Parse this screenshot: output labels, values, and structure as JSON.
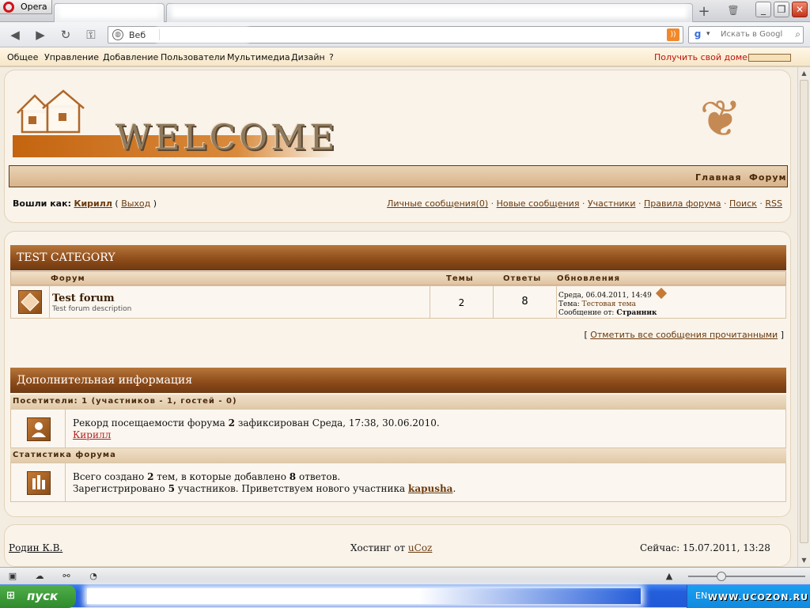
{
  "browser": {
    "opera_label": "Opera",
    "url_label": "Веб",
    "search_placeholder": "Искать в Googl"
  },
  "ucoz_menu": {
    "items": [
      "Общее",
      "Управление",
      "Добавление",
      "Пользователи",
      "Мультимедиа",
      "Дизайн",
      "?"
    ],
    "domain_link": "Получить свой домен"
  },
  "header": {
    "logo_text": "WELCOME",
    "nav": [
      "Главная",
      "Форум"
    ]
  },
  "login": {
    "label": "Вошли как:",
    "user": "Кирилл",
    "paren_open": "(",
    "logout": "Выход",
    "paren_close": ")"
  },
  "user_links": [
    "Личные сообщения(0)",
    "Новые сообщения",
    "Участники",
    "Правила форума",
    "Поиск",
    "RSS"
  ],
  "category": {
    "title": "TEST CATEGORY",
    "columns": [
      "Форум",
      "Темы",
      "Ответы",
      "Обновления"
    ],
    "forum": {
      "name": "Test forum",
      "description": "Test forum description",
      "topics": "2",
      "replies": "8",
      "updated": "Среда, 06.04.2011, 14:49",
      "topic_label": "Тема:",
      "topic_value": "Тестовая тема",
      "author_label": "Сообщение от:",
      "author_value": "Странник"
    },
    "mark_read_open": "[",
    "mark_read": "Отметить все сообщения прочитанными",
    "mark_read_close": "]"
  },
  "extra_info": {
    "title": "Дополнительная информация",
    "visitors_head": "Посетители: 1 (участников - 1, гостей - 0)",
    "record_prefix": "Рекорд посещаемости форума",
    "record_num": "2",
    "record_suffix": "зафиксирован Среда, 17:38, 30.06.2010.",
    "online_user": "Кирилл",
    "stats_head": "Статистика форума",
    "stats_line1_a": "Всего создано",
    "stats_line1_topics": "2",
    "stats_line1_b": "тем, в которые добавлено",
    "stats_line1_replies": "8",
    "stats_line1_c": "ответов.",
    "stats_line2_a": "Зарегистрировано",
    "stats_line2_members": "5",
    "stats_line2_b": "участников. Приветствуем нового участника",
    "stats_line2_newest": "kapusha",
    "stats_line2_c": "."
  },
  "footer": {
    "author": "Родин К.В.",
    "hosting_label": "Хостинг от",
    "hosting_link": "uCoz",
    "now": "Сейчас: 15.07.2011, 13:28"
  },
  "taskbar": {
    "start": "пуск",
    "lang": "EN",
    "watermark": "WWW.UCOZON.RU"
  },
  "colors": {
    "accent_brown": "#8c4a18",
    "link": "#6b3a0d",
    "domain_red": "#c0140e"
  }
}
